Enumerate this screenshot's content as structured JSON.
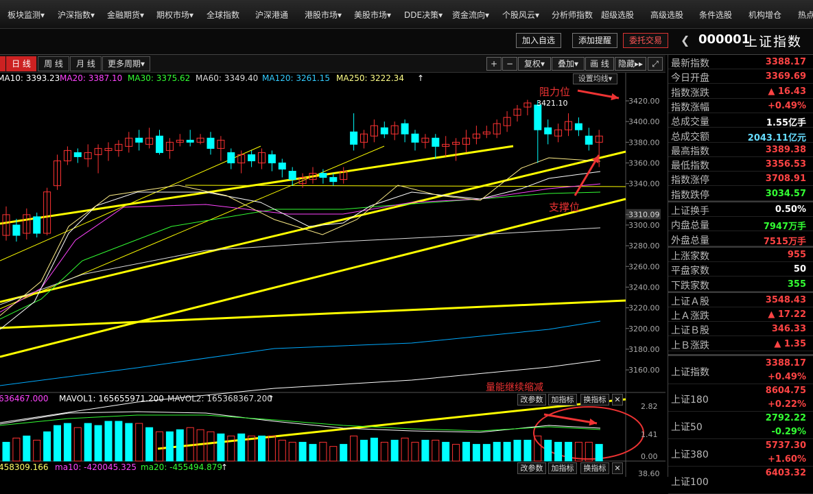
{
  "nav": {
    "items": [
      "板块监测▾",
      "沪深指数▾",
      "金融期货▾",
      "期权市场▾",
      "全球指数",
      "沪深港通",
      "港股市场▾",
      "美股市场▾",
      "DDE决策▾",
      "资金流向▾",
      "个股风云▾",
      "分析师指数",
      "超级选股",
      "高级选股",
      "条件选股",
      "机构增仓",
      "热点"
    ]
  },
  "actions": {
    "add_watch": "加入自选",
    "add_alert": "添加提醒",
    "entrust": "委托交易"
  },
  "stock": {
    "code": "000001",
    "name": "上证指数"
  },
  "period_tabs": [
    "日 线",
    "周 线",
    "月 线",
    "更多周期▾"
  ],
  "chart_tools": [
    "+",
    "−",
    "复权▾",
    "叠加▾",
    "画 线",
    "隐藏▸▸",
    "⤢"
  ],
  "ma_legend": {
    "ma10": "MA10: 3393.23",
    "ma20": "MA20: 3387.10",
    "ma30": "MA30: 3375.62",
    "ma60": "MA60: 3349.40",
    "ma120": "MA120: 3261.15",
    "ma250": "MA250: 3222.34",
    "up": "↑",
    "set_ma": "设置均线▾"
  },
  "colors": {
    "up": "#ff3333",
    "down": "#00ffff",
    "ma10": "#ffffff",
    "ma20": "#ff44ff",
    "ma30": "#33ff33",
    "ma60": "#dddddd",
    "ma120": "#00aaff",
    "ma250": "#ffff88",
    "trend": "#ffff00"
  },
  "price_axis": [
    "3420.00",
    "3400.00",
    "3380.00",
    "3360.00",
    "3340.00",
    "3310.09",
    "3300.00",
    "3280.00",
    "3260.00",
    "3240.00",
    "3220.00",
    "3200.00",
    "3180.00",
    "3160.00"
  ],
  "annotations": {
    "resist": "阻力位",
    "support": "支撑位",
    "volume": "量能继续缩减",
    "high_label": "3421.10"
  },
  "vol_legend": {
    "vol": "636467.000",
    "mavol1": "MAVOL1: 165655971.200",
    "mavol2": "MAVOL2: 165368367.200",
    "up": "↑"
  },
  "vol_axis": [
    "2.82",
    "1.41",
    "0.00"
  ],
  "ind_btns": [
    "改参数",
    "加指标",
    "换指标",
    "✕"
  ],
  "ind2_legend": {
    "v1": "458309.166",
    "ma10": "ma10: -420045.325",
    "ma20": "ma20: -455494.879",
    "up": "↑"
  },
  "ind2_axis": "38.60",
  "quotes": [
    {
      "label": "最新指数",
      "value": "3388.17",
      "color": "#ff4444"
    },
    {
      "label": "今日开盘",
      "value": "3369.69",
      "color": "#ff4444"
    },
    {
      "label": "指数涨跌",
      "value": "▲ 16.43",
      "color": "#ff4444"
    },
    {
      "label": "指数涨幅",
      "value": "+0.49%",
      "color": "#ff4444"
    },
    {
      "label": "总成交量",
      "value": "1.55亿手",
      "color": "#ffffff"
    },
    {
      "label": "总成交额",
      "value": "2043.11亿元",
      "color": "#66ddff"
    },
    {
      "label": "最高指数",
      "value": "3389.38",
      "color": "#ff4444"
    },
    {
      "label": "最低指数",
      "value": "3356.53",
      "color": "#ff4444"
    },
    {
      "label": "指数涨停",
      "value": "3708.91",
      "color": "#ff4444"
    },
    {
      "label": "指数跌停",
      "value": "3034.57",
      "color": "#33ff33"
    },
    {
      "label": "上证换手",
      "value": "0.50%",
      "color": "#ffffff"
    },
    {
      "label": "内盘总量",
      "value": "7947万手",
      "color": "#33ff33"
    },
    {
      "label": "外盘总量",
      "value": "7515万手",
      "color": "#ff4444"
    },
    {
      "label": "上涨家数",
      "value": "955",
      "color": "#ff4444"
    },
    {
      "label": "平盘家数",
      "value": "50",
      "color": "#ffffff"
    },
    {
      "label": "下跌家数",
      "value": "355",
      "color": "#33ff33"
    },
    {
      "label": "上证Ａ股",
      "value": "3548.43",
      "color": "#ff4444"
    },
    {
      "label": "上Ａ涨跌",
      "value": "▲ 17.22",
      "color": "#ff4444"
    },
    {
      "label": "上证Ｂ股",
      "value": "346.33",
      "color": "#ff4444"
    },
    {
      "label": "上Ｂ涨跌",
      "value": "▲ 1.35",
      "color": "#ff4444"
    }
  ],
  "indexes": [
    {
      "label": "上证指数",
      "value": "3388.17",
      "change": "+0.49%",
      "vcolor": "#ff4444",
      "ccolor": "#ff4444"
    },
    {
      "label": "上证180",
      "value": "8604.75",
      "change": "+0.22%",
      "vcolor": "#ff4444",
      "ccolor": "#ff4444"
    },
    {
      "label": "上证50",
      "value": "2792.22",
      "change": "-0.29%",
      "vcolor": "#33ff33",
      "ccolor": "#33ff33"
    },
    {
      "label": "上证380",
      "value": "5737.30",
      "change": "+1.60%",
      "vcolor": "#ff4444",
      "ccolor": "#ff4444"
    },
    {
      "label": "上证100",
      "value": "6403.32",
      "change": "",
      "vcolor": "#ff4444",
      "ccolor": "#ff4444"
    }
  ],
  "candles": [
    [
      3290,
      3310,
      3285,
      3318
    ],
    [
      3300,
      3290,
      3284,
      3306
    ],
    [
      3292,
      3310,
      3286,
      3316
    ],
    [
      3308,
      3292,
      3288,
      3312
    ],
    [
      3292,
      3332,
      3290,
      3336
    ],
    [
      3338,
      3362,
      3334,
      3368
    ],
    [
      3362,
      3372,
      3358,
      3376
    ],
    [
      3370,
      3366,
      3360,
      3374
    ],
    [
      3364,
      3370,
      3356,
      3378
    ],
    [
      3368,
      3374,
      3350,
      3378
    ],
    [
      3372,
      3374,
      3362,
      3380
    ],
    [
      3372,
      3378,
      3366,
      3382
    ],
    [
      3376,
      3384,
      3370,
      3390
    ],
    [
      3384,
      3380,
      3372,
      3392
    ],
    [
      3378,
      3384,
      3374,
      3394
    ],
    [
      3386,
      3370,
      3368,
      3392
    ],
    [
      3372,
      3380,
      3364,
      3384
    ],
    [
      3380,
      3382,
      3376,
      3388
    ],
    [
      3382,
      3380,
      3376,
      3392
    ],
    [
      3380,
      3384,
      3378,
      3388
    ],
    [
      3384,
      3374,
      3368,
      3390
    ],
    [
      3374,
      3382,
      3362,
      3386
    ],
    [
      3370,
      3360,
      3354,
      3374
    ],
    [
      3360,
      3368,
      3350,
      3372
    ],
    [
      3368,
      3362,
      3356,
      3372
    ],
    [
      3360,
      3370,
      3354,
      3374
    ],
    [
      3368,
      3360,
      3352,
      3372
    ],
    [
      3360,
      3354,
      3346,
      3364
    ],
    [
      3352,
      3344,
      3338,
      3356
    ],
    [
      3340,
      3346,
      3336,
      3350
    ],
    [
      3344,
      3350,
      3340,
      3356
    ],
    [
      3350,
      3346,
      3340,
      3354
    ],
    [
      3346,
      3342,
      3338,
      3350
    ],
    [
      3344,
      3352,
      3340,
      3356
    ],
    [
      3390,
      3378,
      3372,
      3408
    ],
    [
      3380,
      3388,
      3374,
      3392
    ],
    [
      3386,
      3396,
      3380,
      3402
    ],
    [
      3394,
      3388,
      3384,
      3400
    ],
    [
      3388,
      3396,
      3382,
      3400
    ],
    [
      3398,
      3388,
      3380,
      3402
    ],
    [
      3388,
      3380,
      3372,
      3392
    ],
    [
      3380,
      3384,
      3374,
      3388
    ],
    [
      3384,
      3376,
      3364,
      3388
    ],
    [
      3376,
      3378,
      3366,
      3386
    ],
    [
      3378,
      3380,
      3362,
      3384
    ],
    [
      3378,
      3384,
      3370,
      3392
    ],
    [
      3384,
      3388,
      3378,
      3396
    ],
    [
      3388,
      3390,
      3384,
      3396
    ],
    [
      3388,
      3398,
      3384,
      3402
    ],
    [
      3396,
      3404,
      3390,
      3410
    ],
    [
      3406,
      3412,
      3400,
      3416
    ],
    [
      3414,
      3418,
      3406,
      3421
    ],
    [
      3416,
      3392,
      3360,
      3420
    ],
    [
      3394,
      3388,
      3378,
      3402
    ],
    [
      3386,
      3392,
      3380,
      3398
    ],
    [
      3392,
      3400,
      3386,
      3408
    ],
    [
      3398,
      3392,
      3386,
      3404
    ],
    [
      3386,
      3378,
      3372,
      3394
    ],
    [
      3380,
      3386,
      3356,
      3392
    ]
  ],
  "volumes": [
    [
      0.9,
      1
    ],
    [
      1.1,
      0
    ],
    [
      1.2,
      1
    ],
    [
      1.0,
      0
    ],
    [
      1.4,
      1
    ],
    [
      1.7,
      1
    ],
    [
      1.8,
      1
    ],
    [
      1.6,
      0
    ],
    [
      1.8,
      1
    ],
    [
      1.7,
      1
    ],
    [
      1.9,
      1
    ],
    [
      1.9,
      1
    ],
    [
      1.8,
      1
    ],
    [
      1.8,
      0
    ],
    [
      1.6,
      1
    ],
    [
      1.4,
      0
    ],
    [
      1.4,
      1
    ],
    [
      1.5,
      1
    ],
    [
      1.6,
      0
    ],
    [
      1.5,
      0
    ],
    [
      1.4,
      0
    ],
    [
      1.3,
      1
    ],
    [
      1.2,
      0
    ],
    [
      1.3,
      1
    ],
    [
      1.2,
      0
    ],
    [
      1.2,
      1
    ],
    [
      1.2,
      0
    ],
    [
      1.0,
      0
    ],
    [
      0.9,
      0
    ],
    [
      0.9,
      1
    ],
    [
      0.8,
      1
    ],
    [
      0.9,
      0
    ],
    [
      0.7,
      0
    ],
    [
      0.8,
      1
    ],
    [
      1.2,
      0
    ],
    [
      1.0,
      1
    ],
    [
      1.1,
      1
    ],
    [
      0.9,
      0
    ],
    [
      1.0,
      1
    ],
    [
      1.1,
      0
    ],
    [
      0.9,
      0
    ],
    [
      1.0,
      1
    ],
    [
      1.0,
      0
    ],
    [
      0.9,
      1
    ],
    [
      0.8,
      0
    ],
    [
      0.9,
      1
    ],
    [
      0.8,
      1
    ],
    [
      0.8,
      1
    ],
    [
      0.9,
      1
    ],
    [
      0.9,
      1
    ],
    [
      1.0,
      1
    ],
    [
      1.0,
      1
    ],
    [
      1.2,
      0
    ],
    [
      1.0,
      1
    ],
    [
      0.9,
      1
    ],
    [
      0.9,
      1
    ],
    [
      0.9,
      0
    ],
    [
      0.9,
      0
    ],
    [
      0.8,
      1
    ]
  ]
}
